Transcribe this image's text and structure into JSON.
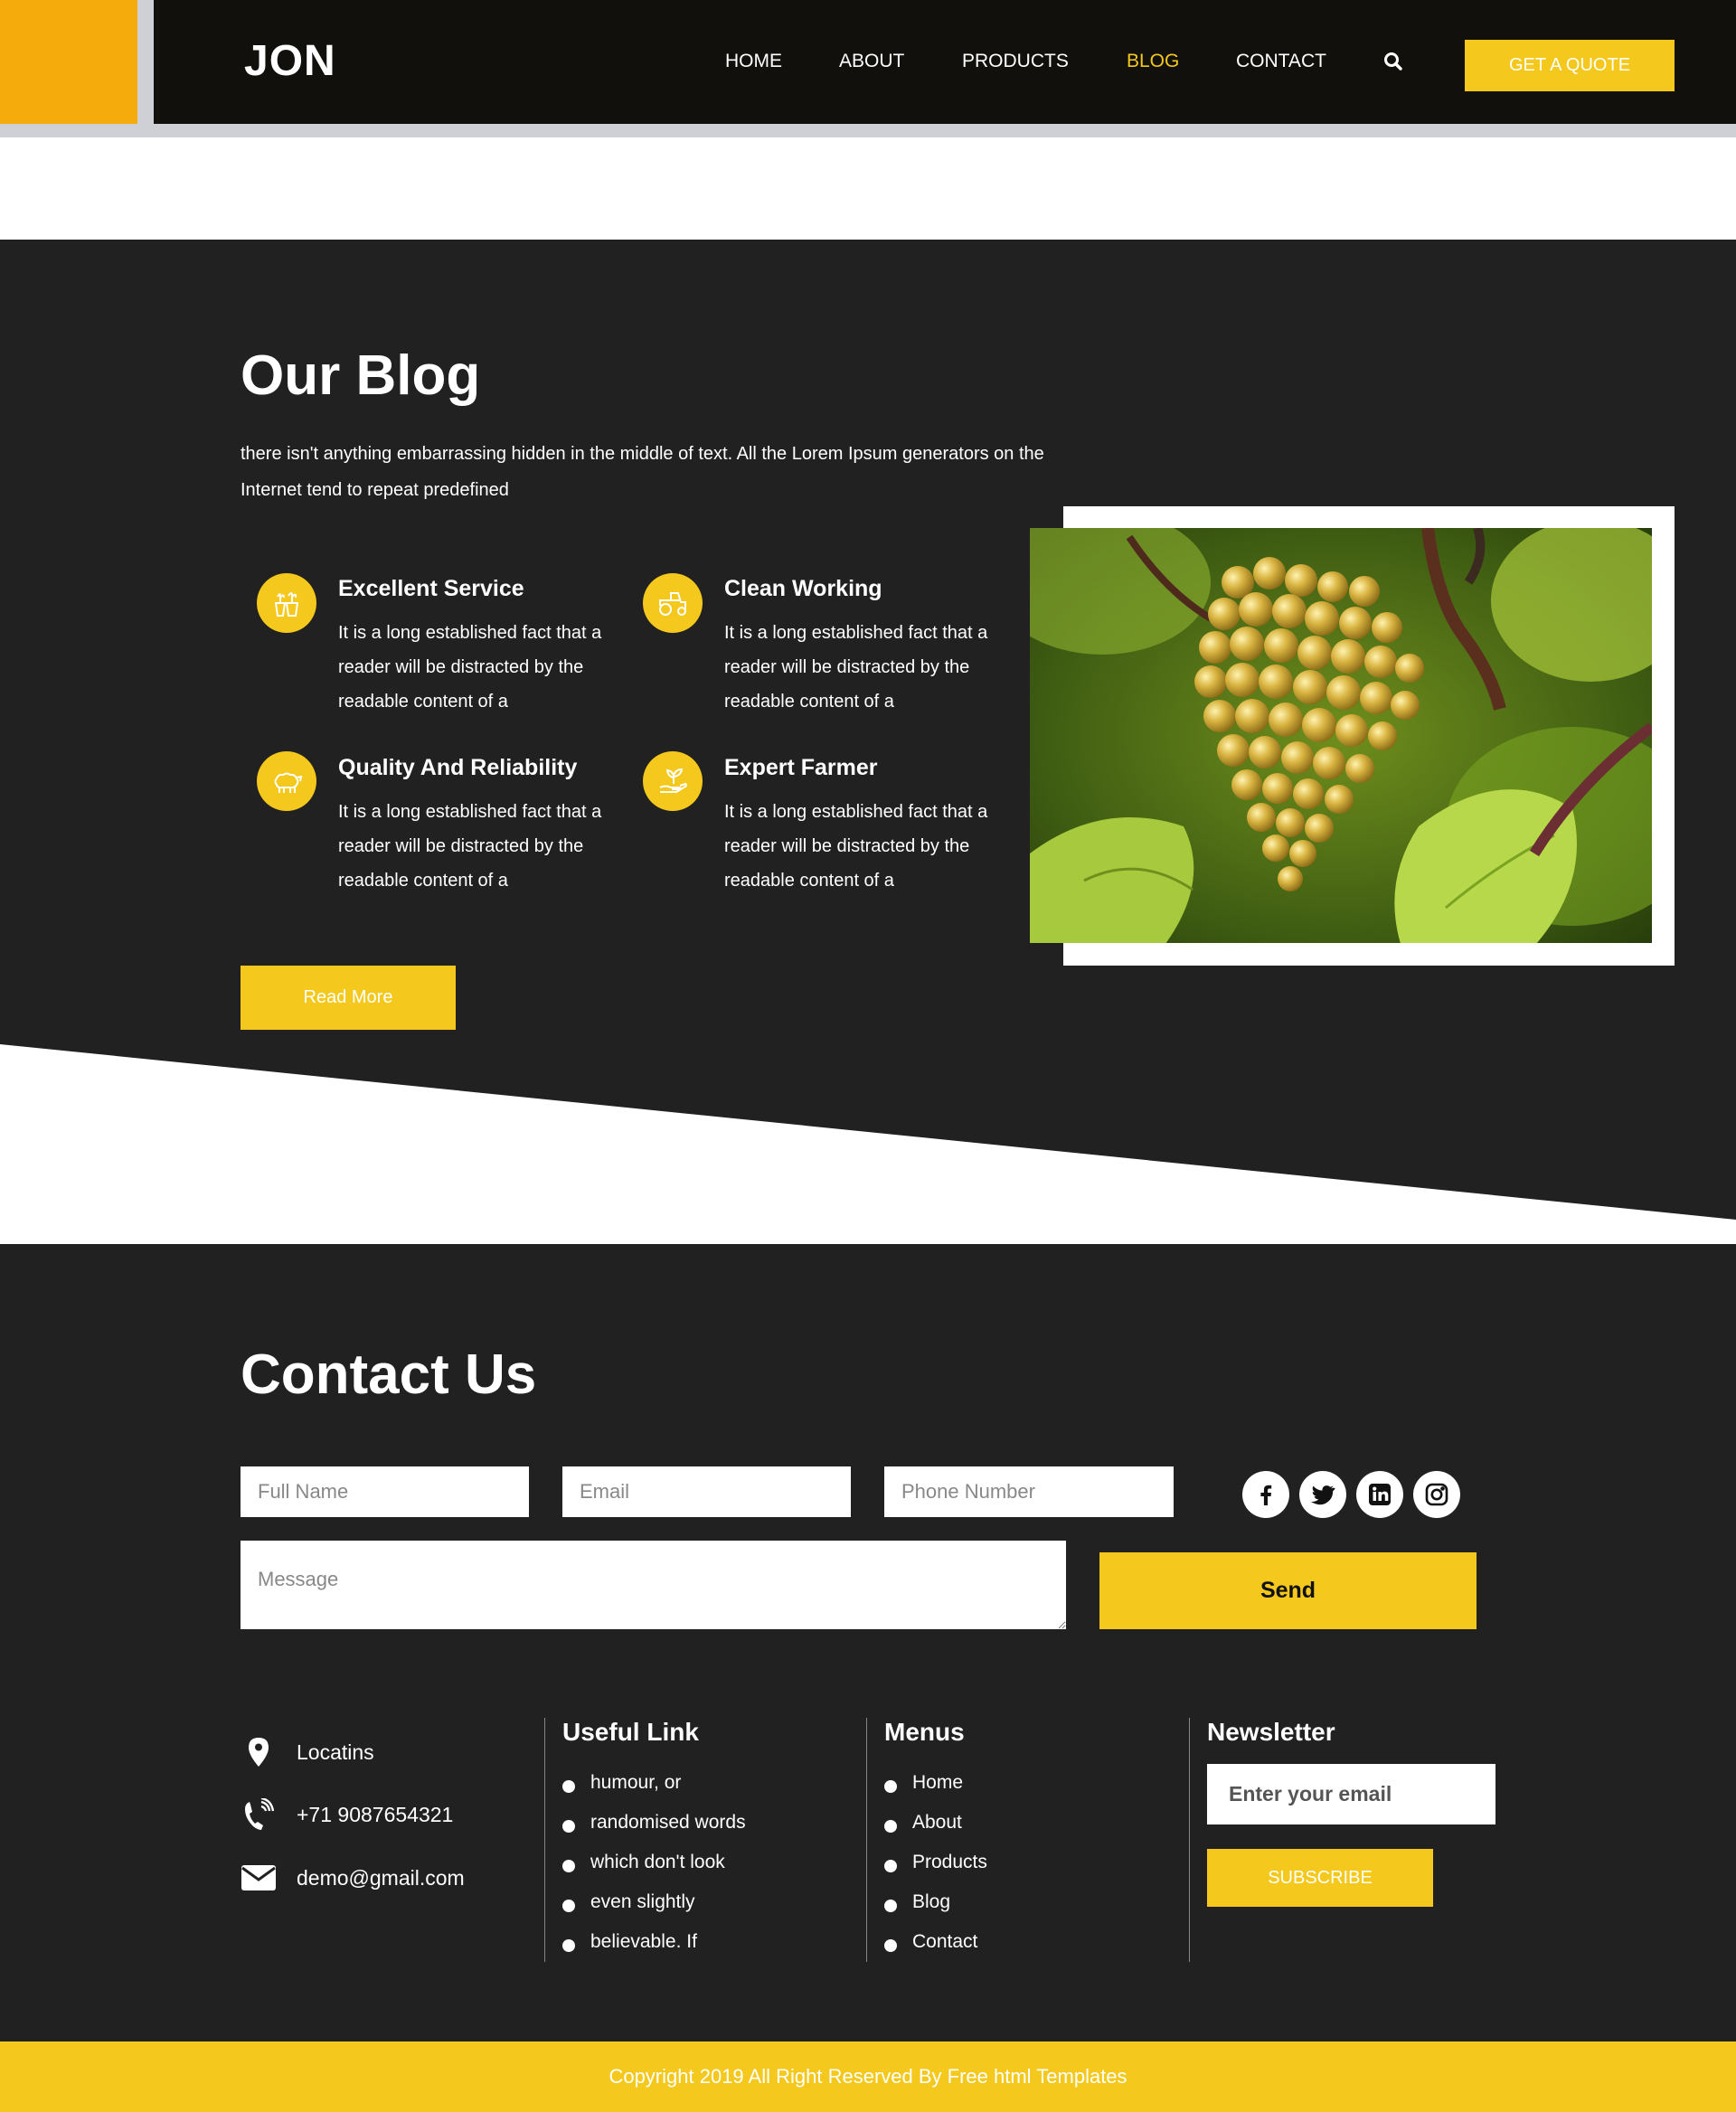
{
  "header": {
    "logo": "JON",
    "nav": [
      "HOME",
      "ABOUT",
      "PRODUCTS",
      "BLOG",
      "CONTACT"
    ],
    "active_nav": "BLOG",
    "quote_label": "GET A QUOTE",
    "icons": {
      "search": "search-icon"
    }
  },
  "blog": {
    "title": "Our Blog",
    "description": "there isn't anything embarrassing hidden in the middle of text. All the Lorem Ipsum generators on the Internet tend to repeat predefined",
    "features": [
      {
        "title": "Excellent Service",
        "text": "It is a long established fact that a reader will be distracted by the readable content of a",
        "icon": "plant-pots-icon"
      },
      {
        "title": "Clean Working",
        "text": "It is a long established fact that a reader will be distracted by the readable content of a",
        "icon": "tractor-icon"
      },
      {
        "title": "Quality And Reliability",
        "text": "It is a long established fact that a reader will be distracted by the readable content of a",
        "icon": "sheep-icon"
      },
      {
        "title": "Expert Farmer",
        "text": "It is a long established fact that a reader will be distracted by the readable content of a",
        "icon": "hand-plant-icon"
      }
    ],
    "read_more": "Read More",
    "image": "grapes-image"
  },
  "contact": {
    "title": "Contact Us",
    "full_name_placeholder": "Full Name",
    "email_placeholder": "Email",
    "phone_placeholder": "Phone Number",
    "message_placeholder": "Message",
    "send_label": "Send",
    "social": [
      "facebook-icon",
      "twitter-icon",
      "linkedin-icon",
      "instagram-icon"
    ]
  },
  "info": {
    "location": "Locatins",
    "phone": "+71 9087654321",
    "email": "demo@gmail.com"
  },
  "useful_link": {
    "title": "Useful Link",
    "items": [
      "humour, or",
      "randomised words",
      "which don't look",
      "even slightly",
      "believable. If"
    ]
  },
  "menus": {
    "title": "Menus",
    "items": [
      "Home",
      "About",
      "Products",
      "Blog",
      "Contact"
    ]
  },
  "newsletter": {
    "title": "Newsletter",
    "placeholder": "Enter your email",
    "subscribe_label": "SUBSCRIBE"
  },
  "footer": {
    "copyright": "Copyright 2019 All Right Reserved By Free html Templates"
  },
  "colors": {
    "accent": "#f4c81c",
    "header_accent": "#f5ab0b",
    "header_bg": "#11100d",
    "section_bg": "#212121"
  }
}
